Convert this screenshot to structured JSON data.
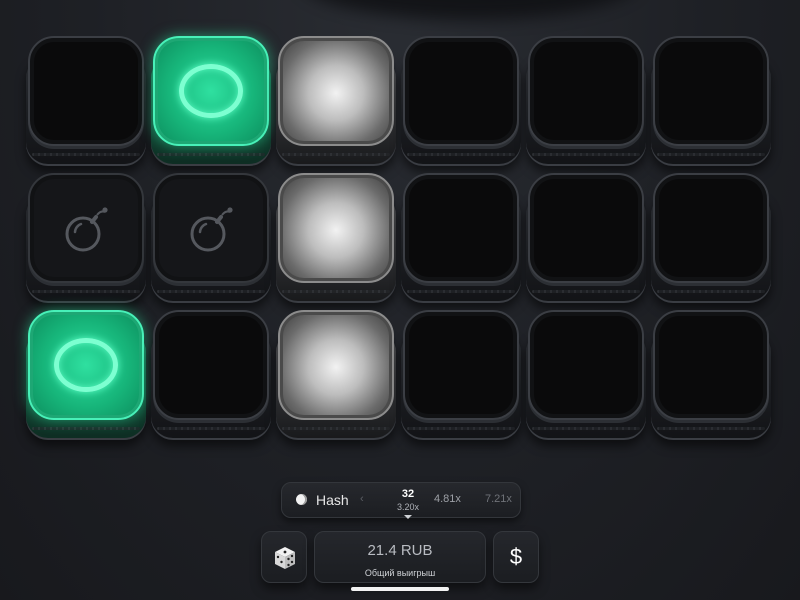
{
  "board": {
    "rows": [
      [
        "empty",
        "gem",
        "silver",
        "empty",
        "empty",
        "empty"
      ],
      [
        "bomb",
        "bomb",
        "silver",
        "empty",
        "empty",
        "empty"
      ],
      [
        "gem",
        "empty",
        "silver",
        "empty",
        "empty",
        "empty"
      ]
    ],
    "colors": {
      "gem": "#2fe0a0",
      "silver": "#d8d8d8",
      "tile": "#0a0a0b"
    }
  },
  "bet_bar": {
    "algorithm": "Hash",
    "options": [
      {
        "count": "32",
        "multiplier": "3.20x",
        "selected": true
      },
      {
        "multiplier": "4.81x"
      },
      {
        "multiplier": "7.21x"
      }
    ]
  },
  "controls": {
    "win_amount": "21.4 RUB",
    "win_label": "Общий выигрыш",
    "dollar_label": "$"
  },
  "icons": {
    "random": "dice-icon",
    "bomb": "bomb-icon",
    "gem": "ring-icon"
  }
}
